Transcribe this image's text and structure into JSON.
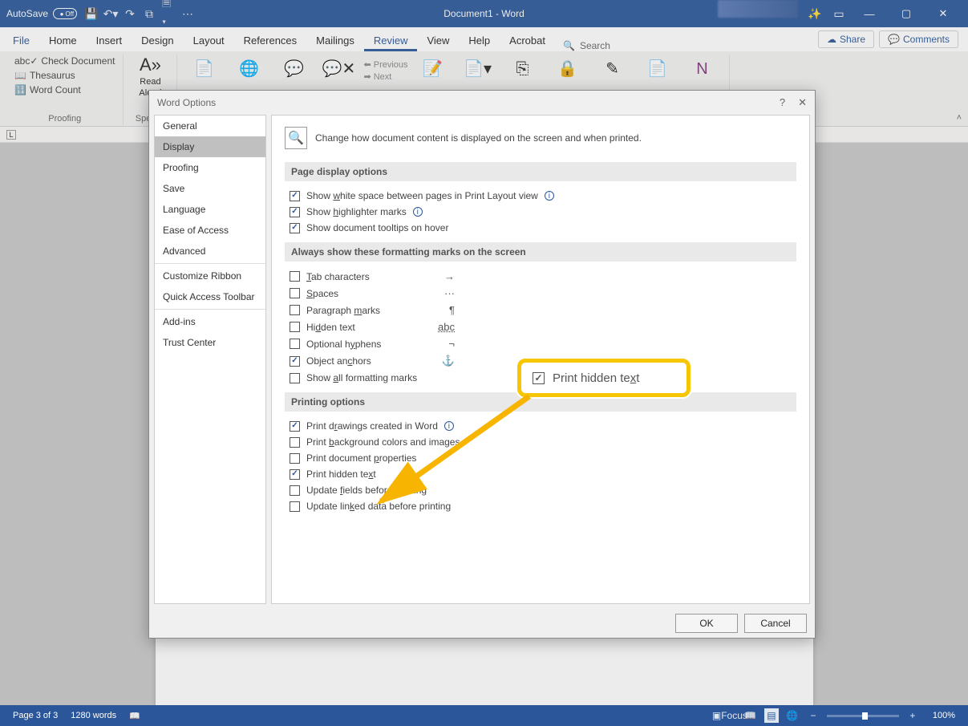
{
  "titlebar": {
    "autosave_label": "AutoSave",
    "autosave_state": "Off",
    "doc_title": "Document1  -  Word"
  },
  "ribbon_tabs": [
    "File",
    "Home",
    "Insert",
    "Design",
    "Layout",
    "References",
    "Mailings",
    "Review",
    "View",
    "Help",
    "Acrobat"
  ],
  "ribbon_active_tab": "Review",
  "search_placeholder": "Search",
  "share_label": "Share",
  "comments_label": "Comments",
  "ribbon": {
    "proofing": {
      "items": [
        "Check Document",
        "Thesaurus",
        "Word Count"
      ],
      "label": "Proofing"
    },
    "speech": {
      "btn": "Read\nAloud",
      "label": "Speech"
    },
    "prev": "Previous",
    "next": "Next"
  },
  "dialog": {
    "title": "Word Options",
    "sidebar": [
      "General",
      "Display",
      "Proofing",
      "Save",
      "Language",
      "Ease of Access",
      "Advanced",
      "Customize Ribbon",
      "Quick Access Toolbar",
      "Add-ins",
      "Trust Center"
    ],
    "sidebar_selected": "Display",
    "header": "Change how document content is displayed on the screen and when printed.",
    "section1_title": "Page display options",
    "sec1": {
      "opt1": "Show white space between pages in Print Layout view",
      "opt2": "Show highlighter marks",
      "opt3": "Show document tooltips on hover"
    },
    "section2_title": "Always show these formatting marks on the screen",
    "sec2": {
      "tab": "Tab characters",
      "spaces": "Spaces",
      "para": "Paragraph marks",
      "hidden": "Hidden text",
      "hyphen": "Optional hyphens",
      "anchors": "Object anchors",
      "all": "Show all formatting marks"
    },
    "sym": {
      "tab": "→",
      "spaces": "···",
      "para": "¶",
      "hidden": "abc",
      "hyphen": "¬",
      "anchors": "⚓"
    },
    "section3_title": "Printing options",
    "sec3": {
      "drawings": "Print drawings created in Word",
      "bg": "Print background colors and images",
      "props": "Print document properties",
      "hidden": "Print hidden text",
      "fields": "Update fields before printing",
      "linked": "Update linked data before printing"
    },
    "ok": "OK",
    "cancel": "Cancel"
  },
  "callout_label": "Print hidden text",
  "statusbar": {
    "page": "Page 3 of 3",
    "words": "1280 words",
    "focus": "Focus",
    "zoom": "100%"
  }
}
